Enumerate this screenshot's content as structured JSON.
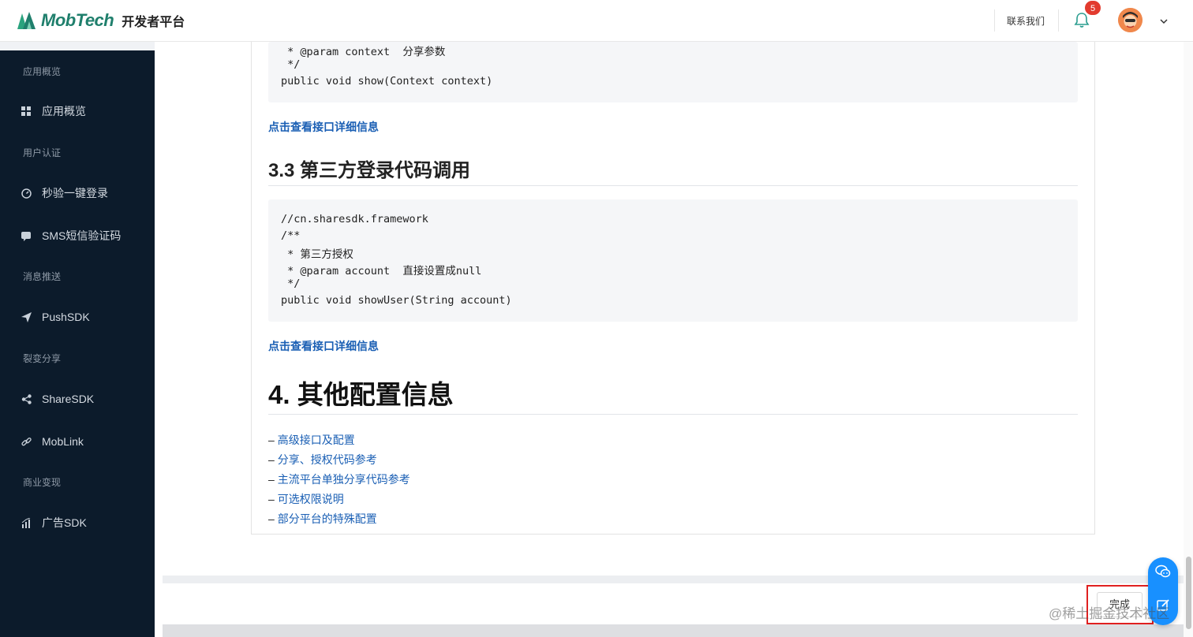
{
  "header": {
    "brand": "MobTech",
    "subtitle": "开发者平台",
    "contact": "联系我们",
    "notification_count": "5"
  },
  "sidebar": {
    "groups": [
      {
        "label": "应用概览",
        "items": [
          {
            "label": "应用概览",
            "icon": "dashboard-icon"
          }
        ]
      },
      {
        "label": "用户认证",
        "items": [
          {
            "label": "秒验一键登录",
            "icon": "speedometer-icon"
          },
          {
            "label": "SMS短信验证码",
            "icon": "message-icon"
          }
        ]
      },
      {
        "label": "消息推送",
        "items": [
          {
            "label": "PushSDK",
            "icon": "send-icon"
          }
        ]
      },
      {
        "label": "裂变分享",
        "items": [
          {
            "label": "ShareSDK",
            "icon": "share-icon"
          }
        ]
      },
      {
        "label": "",
        "items": [
          {
            "label": "MobLink",
            "icon": "link-icon"
          }
        ]
      },
      {
        "label": "商业变现",
        "items": [
          {
            "label": "广告SDK",
            "icon": "chart-icon"
          }
        ]
      }
    ]
  },
  "content": {
    "code1": [
      " * @param context  分享参数",
      " */",
      "public void show(Context context)"
    ],
    "link1": "点击查看接口详细信息",
    "section_3_3": "3.3 第三方登录代码调用",
    "code2": [
      "//cn.sharesdk.framework",
      "/**",
      " * 第三方授权",
      " * @param account  直接设置成null",
      " */",
      "public void showUser(String account)"
    ],
    "link2": "点击查看接口详细信息",
    "section_4": "4. 其他配置信息",
    "list": [
      {
        "dash": "–",
        "text": "高级接口及配置"
      },
      {
        "dash": "–",
        "text": "分享、授权代码参考"
      },
      {
        "dash": "–",
        "text": "主流平台单独分享代码参考"
      },
      {
        "dash": "–",
        "text": "可选权限说明"
      },
      {
        "dash": "–",
        "text": "部分平台的特殊配置"
      }
    ]
  },
  "footer": {
    "done_label": "完成",
    "watermark": "@稀土掘金技术社区"
  },
  "colors": {
    "sidebar_bg": "#0c1b2b",
    "link": "#1a5fb4",
    "brand": "#1f7f6c",
    "float_button": "#1890ff",
    "highlight_box": "#e02020"
  }
}
